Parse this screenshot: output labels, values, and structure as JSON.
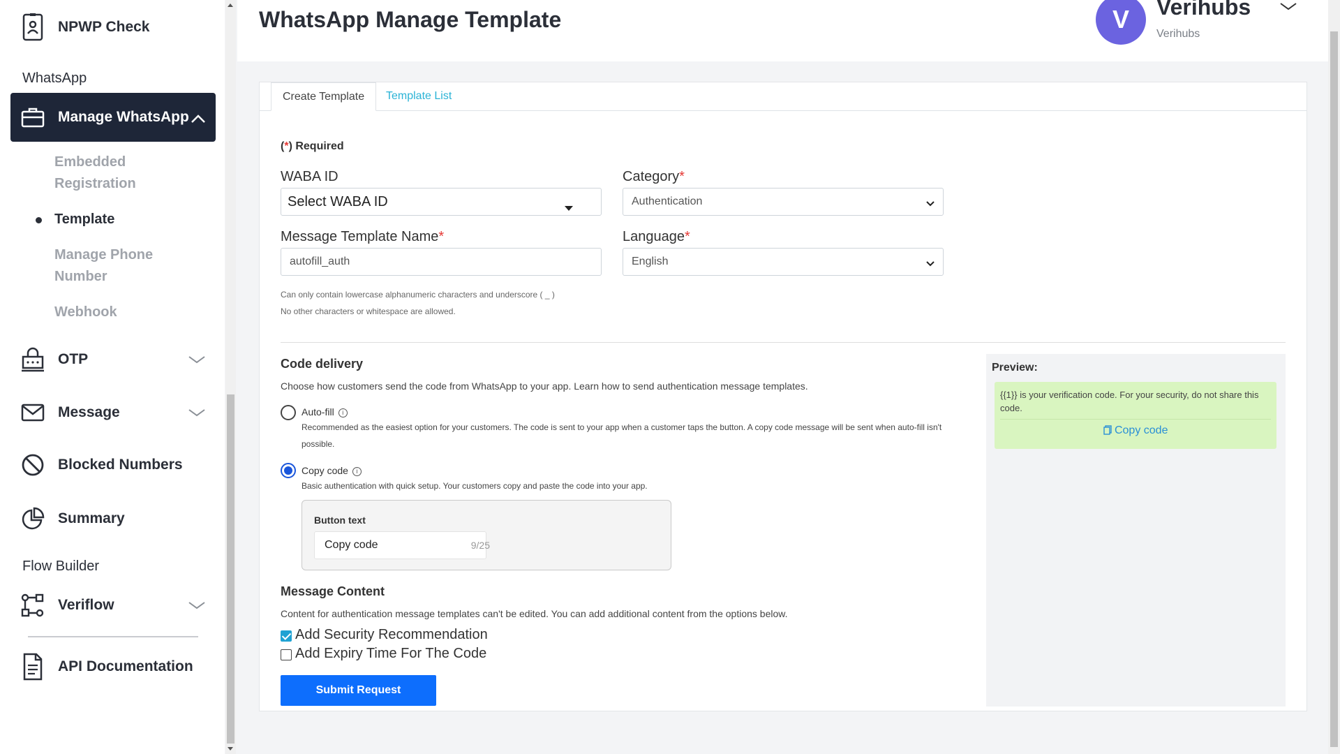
{
  "sidebar": {
    "top_item": "NPWP Check",
    "section_whatsapp": "WhatsApp",
    "manage_whatsapp": "Manage WhatsApp",
    "sub_embedded": "Embedded Registration",
    "sub_template": "Template",
    "sub_manage_phone": "Manage Phone Number",
    "sub_webhook": "Webhook",
    "otp": "OTP",
    "message": "Message",
    "blocked_numbers": "Blocked Numbers",
    "summary": "Summary",
    "section_flow": "Flow Builder",
    "veriflow": "Veriflow",
    "api_docs": "API Documentation"
  },
  "header": {
    "title": "WhatsApp Manage Template",
    "avatar_letter": "V",
    "user_name": "Verihubs",
    "user_sub": "Verihubs"
  },
  "tabs": {
    "create": "Create Template",
    "list": "Template List"
  },
  "form": {
    "required_note": "(*) Required",
    "waba_label": "WABA ID",
    "waba_value": "Select WABA ID",
    "category_label": "Category",
    "category_value": "Authentication",
    "name_label": "Message Template Name",
    "name_value": "autofill_auth",
    "language_label": "Language",
    "language_value": "English",
    "hint1": "Can only contain lowercase alphanumeric characters and underscore ( _ )",
    "hint2": "No other characters or whitespace are allowed."
  },
  "code_delivery": {
    "title": "Code delivery",
    "desc": "Choose how customers send the code from WhatsApp to your app. Learn how to send authentication message templates.",
    "autofill_label": "Auto-fill",
    "autofill_desc": "Recommended as the easiest option for your customers. The code is sent to your app when a customer taps the button. A copy code message will be sent when auto-fill isn't possible.",
    "copy_label": "Copy code",
    "copy_desc": "Basic authentication with quick setup. Your customers copy and paste the code into your app.",
    "selected": "copy",
    "button_text_label": "Button text",
    "button_text_value": "Copy code",
    "button_text_count": "9/25"
  },
  "message_content": {
    "title": "Message Content",
    "desc": "Content for authentication message templates can't be edited. You can add additional content from the options below.",
    "security_label": "Add Security Recommendation",
    "security_checked": true,
    "expiry_label": "Add Expiry Time For The Code",
    "expiry_checked": false
  },
  "submit_label": "Submit Request",
  "preview": {
    "title": "Preview:",
    "text": "{{1}} is your verification code. For your security, do not share this code.",
    "copy": "Copy code"
  },
  "colors": {
    "sidebar_active": "#1e2638",
    "accent_blue": "#0d6efd",
    "link": "#2bb3d6",
    "avatar": "#6b63e0",
    "preview_bubble": "#d9f5c0"
  }
}
